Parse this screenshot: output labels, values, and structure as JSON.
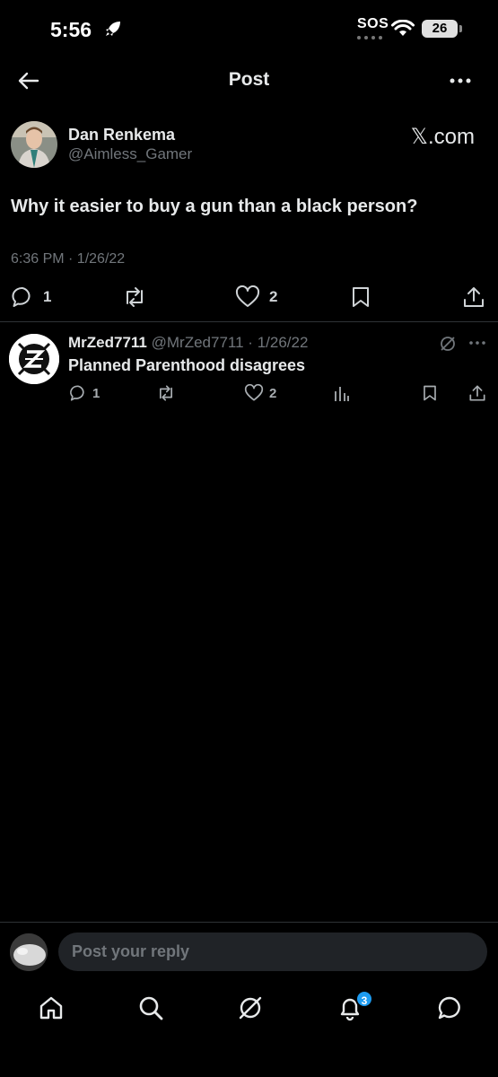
{
  "status_bar": {
    "time": "5:56",
    "sos": "SOS",
    "battery": "26"
  },
  "header": {
    "title": "Post"
  },
  "post": {
    "author_name": "Dan Renkema",
    "author_handle": "@Aimless_Gamer",
    "source_label": "𝕏.com",
    "text": "Why it easier to buy a gun than a black person?",
    "timestamp": "6:36 PM · 1/26/22",
    "replies": "1",
    "reposts": "",
    "likes": "2"
  },
  "reply": {
    "name": "MrZed7711",
    "handle": "@MrZed7711",
    "separator": "·",
    "date": "1/26/22",
    "text": "Planned Parenthood disagrees",
    "replies": "1",
    "likes": "2"
  },
  "composer": {
    "placeholder": "Post your reply"
  },
  "nav": {
    "notifications_badge": "3",
    "items": [
      "home-icon",
      "search-icon",
      "grok-icon",
      "bell-icon",
      "messages-icon"
    ]
  },
  "colors": {
    "background": "#000000",
    "text_primary": "#e7e9ea",
    "text_secondary": "#71767b",
    "accent": "#1d9bf0",
    "divider": "#2f3336"
  }
}
